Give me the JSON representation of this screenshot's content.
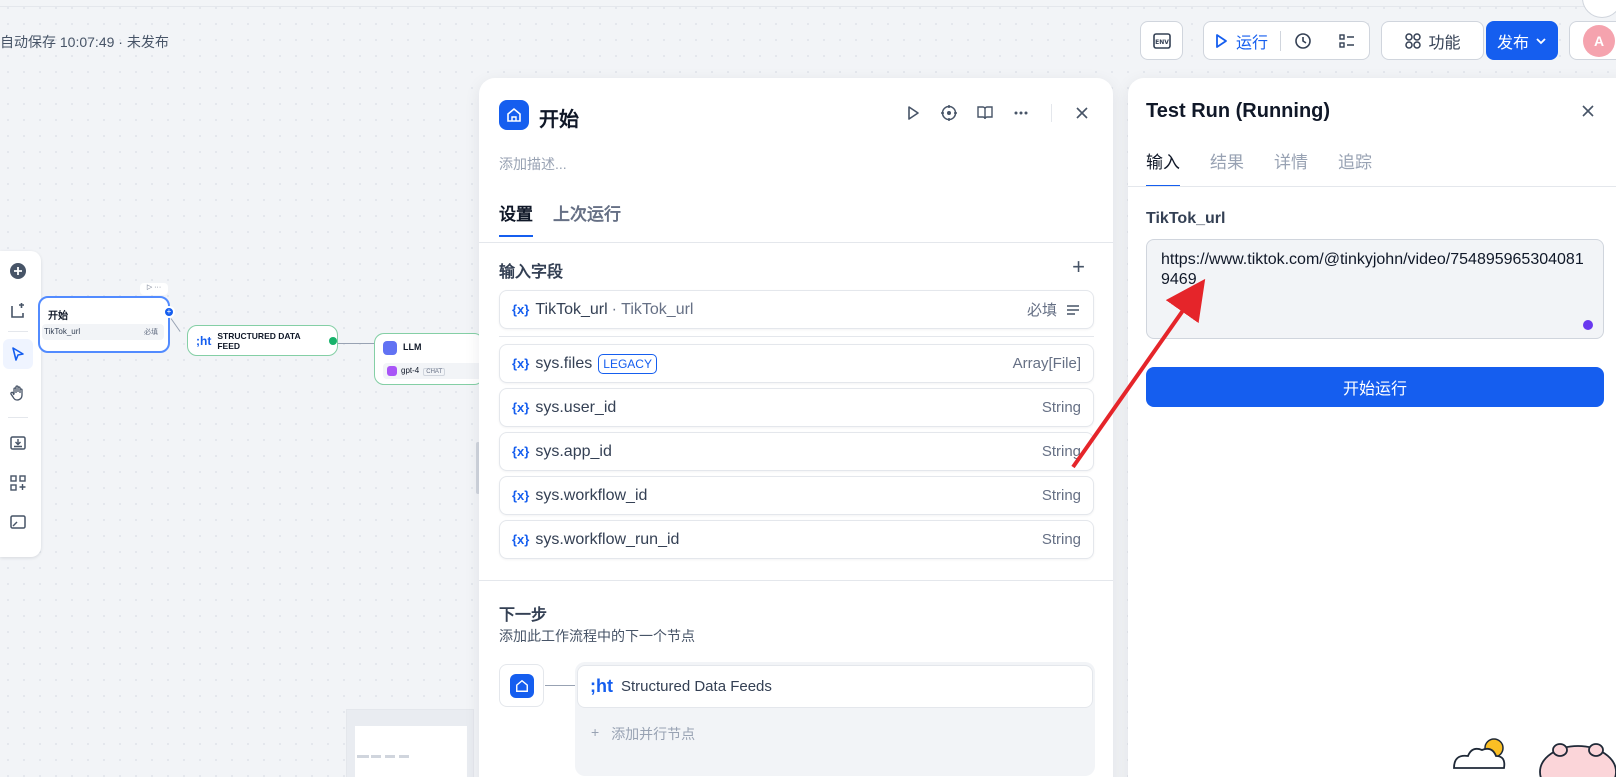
{
  "autosave": "自动保存 10:07:49 · 未发布",
  "toolbar": {
    "run_label": "运行",
    "feature_label": "功能",
    "publish_label": "发布",
    "env_icon": "env-icon",
    "accent": "#155eef"
  },
  "canvas": {
    "start_node_title": "开始",
    "start_node_field": "TikTok_url",
    "start_node_required": "必填",
    "sdf_node_title": "STRUCTURED DATA FEED",
    "llm_node_title": "LLM",
    "llm_model": "gpt-4",
    "llm_mode": "CHAT"
  },
  "center_panel": {
    "title": "开始",
    "description_placeholder": "添加描述...",
    "tabs": [
      "设置",
      "上次运行"
    ],
    "input_section_title": "输入字段",
    "user_vars": [
      {
        "name": "TikTok_url",
        "label": "TikTok_url",
        "right": "必填"
      }
    ],
    "sys_vars": [
      {
        "name": "sys.files",
        "tag": "LEGACY",
        "type": "Array[File]"
      },
      {
        "name": "sys.user_id",
        "type": "String"
      },
      {
        "name": "sys.app_id",
        "type": "String"
      },
      {
        "name": "sys.workflow_id",
        "type": "String"
      },
      {
        "name": "sys.workflow_run_id",
        "type": "String"
      }
    ],
    "var_prefix": "{x}",
    "next_step_title": "下一步",
    "next_step_desc": "添加此工作流程中的下一个节点",
    "next_node": "Structured Data Feeds",
    "next_node_icon_text": ";ht",
    "add_parallel": "添加并行节点"
  },
  "right_panel": {
    "title": "Test Run (Running)",
    "tabs": [
      "输入",
      "结果",
      "详情",
      "追踪"
    ],
    "field_label": "TikTok_url",
    "field_value": "https://www.tiktok.com/@tinkyjohn/video/7548959653040819469",
    "run_button": "开始运行"
  },
  "annotation": {
    "arrow_color": "#e5252a"
  }
}
